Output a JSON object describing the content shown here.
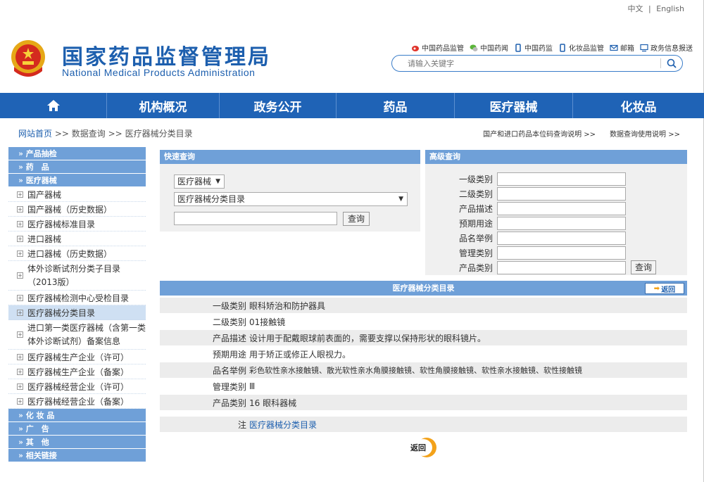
{
  "lang": {
    "zh": "中文",
    "sep": "|",
    "en": "English"
  },
  "header": {
    "title_cn": "国家药品监督管理局",
    "title_en": "National Medical Products Administration",
    "links": [
      "中国药品监管",
      "中国药闻",
      "中国药监",
      "化妆品监管",
      "邮箱",
      "政务信息报送"
    ],
    "search_placeholder": "请输入关键字"
  },
  "nav": {
    "items": [
      "机构概况",
      "政务公开",
      "药品",
      "医疗器械",
      "化妆品"
    ]
  },
  "breadcrumb": {
    "home": "网站首页",
    "sep1": ">>",
    "data": "数据查询",
    "sep2": ">>",
    "current": "医疗器械分类目录",
    "right1": "国产和进口药品本位码查询说明 >>",
    "right2": "数据查询使用说明 >>"
  },
  "sidebar": {
    "heads_top": [
      "» 产品抽检",
      "» 药　品",
      "» 医疗器械"
    ],
    "items": [
      "国产器械",
      "国产器械（历史数据）",
      "医疗器械标准目录",
      "进口器械",
      "进口器械（历史数据）",
      "体外诊断试剂分类子目录（2013版）",
      "医疗器械检测中心受检目录",
      "医疗器械分类目录",
      "进口第一类医疗器械（含第一类体外诊断试剂）备案信息",
      "医疗器械生产企业（许可）",
      "医疗器械生产企业（备案）",
      "医疗器械经营企业（许可）",
      "医疗器械经营企业（备案）"
    ],
    "heads_bottom": [
      "» 化 妆 品",
      "» 广　告",
      "» 其　他",
      "» 相关链接"
    ]
  },
  "quick_search": {
    "title": "快速查询",
    "category": "医疗器械",
    "database": "医疗器械分类目录",
    "button": "查询"
  },
  "advanced_search": {
    "title": "高级查询",
    "fields": [
      "一级类别",
      "二级类别",
      "产品描述",
      "预期用途",
      "品名举例",
      "管理类别",
      "产品类别"
    ],
    "button": "查询"
  },
  "result": {
    "title": "医疗器械分类目录",
    "back_label": "返回",
    "rows": [
      {
        "k": "一级类别",
        "v": "眼科矫治和防护器具"
      },
      {
        "k": "二级类别",
        "v": "01接触镜"
      },
      {
        "k": "产品描述",
        "v": "设计用于配戴眼球前表面的，需要支撑以保持形状的眼科镜片。"
      },
      {
        "k": "预期用途",
        "v": "用于矫正或修正人眼视力。"
      },
      {
        "k": "品名举例",
        "v": "彩色软性亲水接触镜、散光软性亲水角膜接触镜、软性角膜接触镜、软性亲水接触镜、软性接触镜"
      },
      {
        "k": "管理类别",
        "v": "Ⅲ"
      },
      {
        "k": "产品类别",
        "v": "16 眼科器械"
      }
    ],
    "note_key": "注",
    "note_value": "医疗器械分类目录",
    "back_bottom": "返回"
  }
}
